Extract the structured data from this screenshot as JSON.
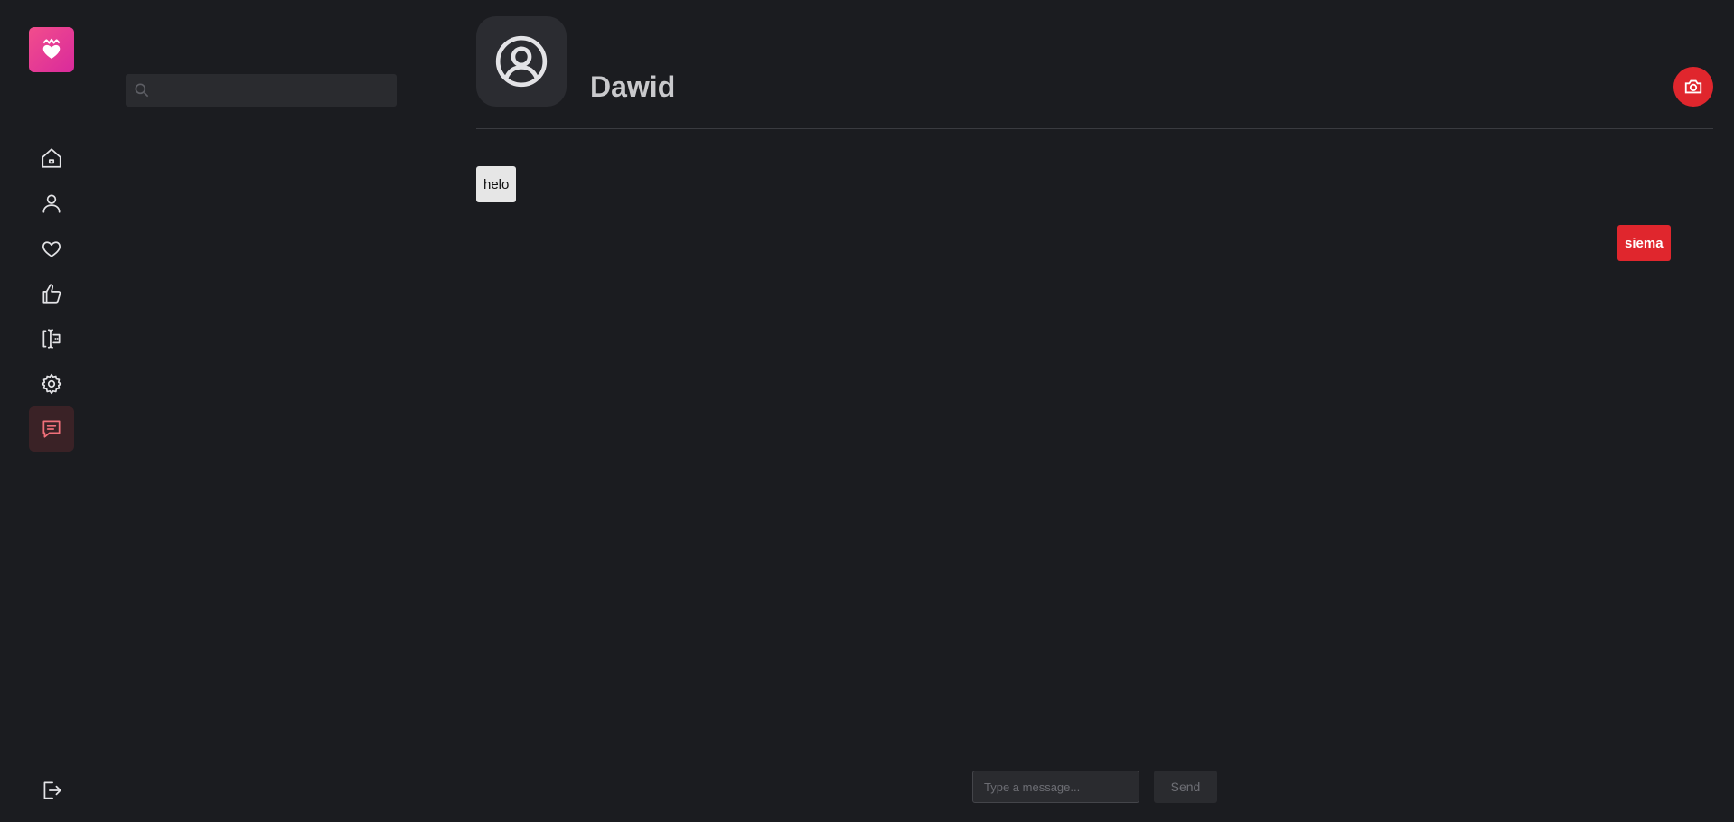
{
  "nav": {
    "logo": "heart-crown-logo",
    "items": [
      {
        "icon": "home-icon"
      },
      {
        "icon": "user-icon"
      },
      {
        "icon": "heart-icon"
      },
      {
        "icon": "thumbs-up-icon"
      },
      {
        "icon": "text-cursor-icon"
      },
      {
        "icon": "gear-icon"
      },
      {
        "icon": "chat-icon",
        "active": true
      }
    ],
    "logout_icon": "logout-icon"
  },
  "search": {
    "placeholder": "",
    "value": ""
  },
  "chat": {
    "name": "Dawid",
    "avatar_icon": "user-circle-icon",
    "camera_icon": "camera-icon",
    "messages": [
      {
        "text": "helo",
        "direction": "incoming"
      },
      {
        "text": "siema",
        "direction": "outgoing"
      }
    ]
  },
  "composer": {
    "placeholder": "Type a message...",
    "send_label": "Send"
  },
  "colors": {
    "background": "#1b1c20",
    "accent": "#e0262d",
    "logo_gradient": [
      "#f24d8c",
      "#d92a9c"
    ]
  }
}
